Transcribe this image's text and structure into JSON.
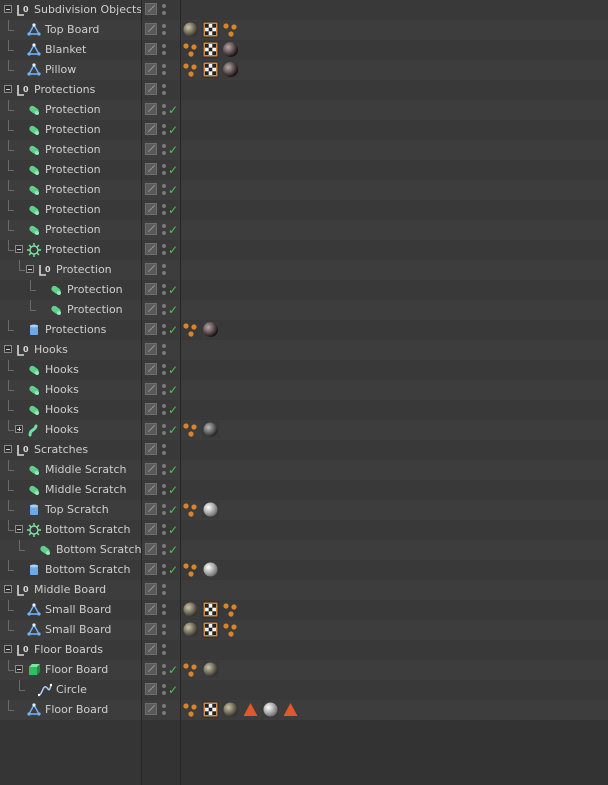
{
  "rows": [
    {
      "label": "Subdivision Objects",
      "depth": 0,
      "icon": "null-object-icon",
      "expander": "minus",
      "check": false,
      "tags": []
    },
    {
      "label": "Top Board",
      "depth": 1,
      "icon": "polygon-object-icon",
      "expander": "",
      "check": false,
      "tags": [
        "sphere-material-tag-icon",
        "checker-material-tag-icon",
        "phong-tag-icon"
      ]
    },
    {
      "label": "Blanket",
      "depth": 1,
      "icon": "polygon-object-icon",
      "expander": "",
      "check": false,
      "tags": [
        "phong-tag-icon",
        "checker-material-tag-icon",
        "dark-material-tag-icon"
      ]
    },
    {
      "label": "Pillow",
      "depth": 1,
      "icon": "polygon-object-icon",
      "expander": "",
      "check": false,
      "tags": [
        "phong-tag-icon",
        "checker-material-tag-icon",
        "dark-material-tag-icon"
      ]
    },
    {
      "label": "Protections",
      "depth": 0,
      "icon": "null-object-icon",
      "expander": "minus",
      "check": false,
      "tags": []
    },
    {
      "label": "Protection",
      "depth": 1,
      "icon": "capsule-icon",
      "expander": "",
      "check": true,
      "tags": []
    },
    {
      "label": "Protection",
      "depth": 1,
      "icon": "capsule-icon",
      "expander": "",
      "check": true,
      "tags": []
    },
    {
      "label": "Protection",
      "depth": 1,
      "icon": "capsule-icon",
      "expander": "",
      "check": true,
      "tags": []
    },
    {
      "label": "Protection",
      "depth": 1,
      "icon": "capsule-icon",
      "expander": "",
      "check": true,
      "tags": []
    },
    {
      "label": "Protection",
      "depth": 1,
      "icon": "capsule-icon",
      "expander": "",
      "check": true,
      "tags": []
    },
    {
      "label": "Protection",
      "depth": 1,
      "icon": "capsule-icon",
      "expander": "",
      "check": true,
      "tags": []
    },
    {
      "label": "Protection",
      "depth": 1,
      "icon": "capsule-icon",
      "expander": "",
      "check": true,
      "tags": []
    },
    {
      "label": "Protection",
      "depth": 1,
      "icon": "array-icon",
      "expander": "minus",
      "check": true,
      "tags": []
    },
    {
      "label": "Protection",
      "depth": 2,
      "icon": "null-object-icon",
      "expander": "minus",
      "check": false,
      "tags": []
    },
    {
      "label": "Protection",
      "depth": 3,
      "icon": "capsule-icon",
      "expander": "",
      "check": true,
      "tags": []
    },
    {
      "label": "Protection",
      "depth": 3,
      "icon": "capsule-icon",
      "expander": "",
      "check": true,
      "tags": []
    },
    {
      "label": "Protections",
      "depth": 1,
      "icon": "cylinder-icon",
      "expander": "",
      "check": true,
      "tags": [
        "phong-tag-icon",
        "dark-material-tag-icon"
      ]
    },
    {
      "label": "Hooks",
      "depth": 0,
      "icon": "null-object-icon",
      "expander": "minus",
      "check": false,
      "tags": []
    },
    {
      "label": "Hooks",
      "depth": 1,
      "icon": "capsule-icon",
      "expander": "",
      "check": true,
      "tags": []
    },
    {
      "label": "Hooks",
      "depth": 1,
      "icon": "capsule-icon",
      "expander": "",
      "check": true,
      "tags": []
    },
    {
      "label": "Hooks",
      "depth": 1,
      "icon": "capsule-icon",
      "expander": "",
      "check": true,
      "tags": []
    },
    {
      "label": "Hooks",
      "depth": 1,
      "icon": "bend-icon",
      "expander": "plus",
      "check": true,
      "tags": [
        "phong-tag-icon",
        "grey-material-tag-icon"
      ]
    },
    {
      "label": "Scratches",
      "depth": 0,
      "icon": "null-object-icon",
      "expander": "minus",
      "check": false,
      "tags": []
    },
    {
      "label": "Middle Scratch",
      "depth": 1,
      "icon": "capsule-icon",
      "expander": "",
      "check": true,
      "tags": []
    },
    {
      "label": "Middle Scratch",
      "depth": 1,
      "icon": "capsule-icon",
      "expander": "",
      "check": true,
      "tags": []
    },
    {
      "label": "Top Scratch",
      "depth": 1,
      "icon": "cylinder-icon",
      "expander": "",
      "check": true,
      "tags": [
        "phong-tag-icon",
        "light-material-tag-icon"
      ]
    },
    {
      "label": "Bottom Scratch",
      "depth": 1,
      "icon": "array-icon",
      "expander": "minus",
      "check": true,
      "tags": []
    },
    {
      "label": "Bottom Scratch",
      "depth": 2,
      "icon": "capsule-icon",
      "expander": "",
      "check": true,
      "tags": []
    },
    {
      "label": "Bottom Scratch",
      "depth": 1,
      "icon": "cylinder-icon",
      "expander": "",
      "check": true,
      "tags": [
        "phong-tag-icon",
        "light-material-tag-icon"
      ]
    },
    {
      "label": "Middle Board",
      "depth": 0,
      "icon": "null-object-icon",
      "expander": "minus",
      "check": false,
      "tags": []
    },
    {
      "label": "Small Board",
      "depth": 1,
      "icon": "polygon-object-icon",
      "expander": "",
      "check": false,
      "tags": [
        "sphere-material-tag-icon",
        "checker-material-tag-icon",
        "phong-tag-icon"
      ]
    },
    {
      "label": "Small Board",
      "depth": 1,
      "icon": "polygon-object-icon",
      "expander": "",
      "check": false,
      "tags": [
        "sphere-material-tag-icon",
        "checker-material-tag-icon",
        "phong-tag-icon"
      ]
    },
    {
      "label": "Floor Boards",
      "depth": 0,
      "icon": "null-object-icon",
      "expander": "minus",
      "check": false,
      "tags": []
    },
    {
      "label": "Floor Board",
      "depth": 1,
      "icon": "extrude-icon",
      "expander": "minus",
      "check": true,
      "tags": [
        "phong-tag-icon",
        "sphere-material-tag-icon"
      ]
    },
    {
      "label": "Circle",
      "depth": 2,
      "icon": "spline-icon",
      "expander": "",
      "check": true,
      "tags": []
    },
    {
      "label": "Floor Board",
      "depth": 1,
      "icon": "polygon-object-icon",
      "expander": "",
      "check": false,
      "tags": [
        "phong-tag-icon",
        "checker-material-tag-icon",
        "sphere-material-tag-icon",
        "warning-tag-icon",
        "light-material-tag-icon",
        "warning-tag-icon"
      ]
    }
  ],
  "colors": {
    "check": "#4fc24f",
    "text": "#cfcfcf",
    "row_odd": "#393939",
    "row_even": "#3d3d3d"
  }
}
